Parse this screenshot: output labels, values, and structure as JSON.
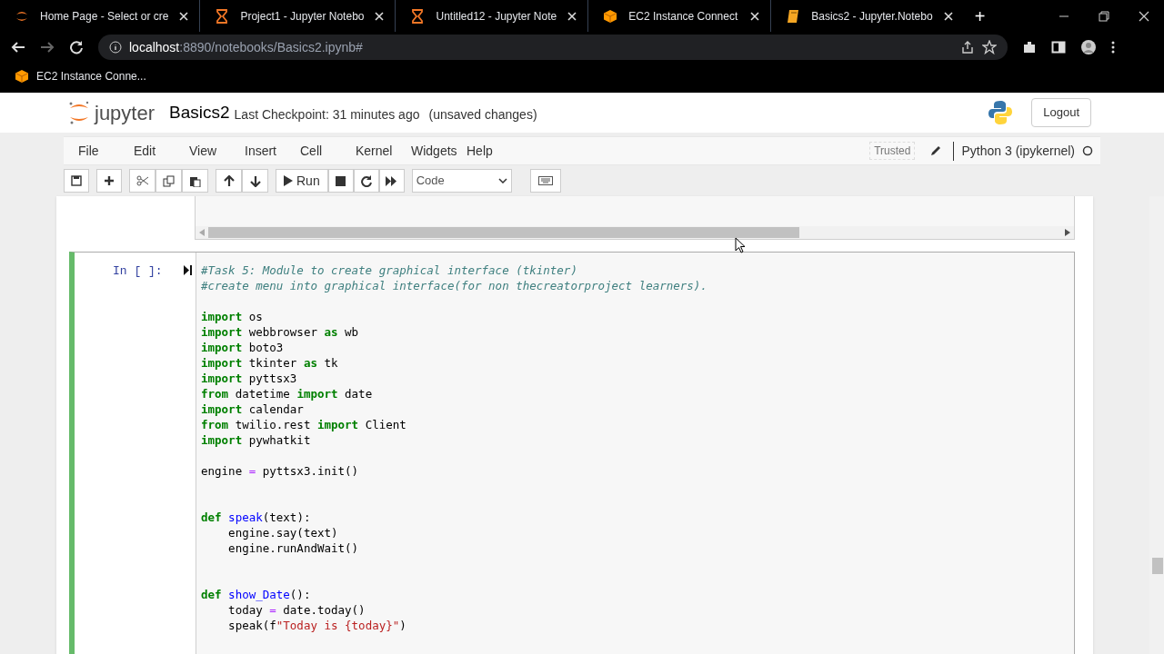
{
  "browser": {
    "tabs": [
      {
        "kind": "jupyter",
        "title": "Home Page - Select or cre"
      },
      {
        "kind": "hourglass",
        "title": "Project1 - Jupyter Notebo"
      },
      {
        "kind": "hourglass",
        "title": "Untitled12 - Jupyter Note"
      },
      {
        "kind": "cube",
        "title": "EC2 Instance Connect"
      },
      {
        "kind": "book",
        "title": "Basics2 - Jupyter.Notebo"
      }
    ],
    "new_tab": "+",
    "url_host": "localhost",
    "url_rest": ":8890/notebooks/Basics2.ipynb#",
    "bookmarks": [
      {
        "kind": "cube",
        "title": "EC2 Instance Conne..."
      }
    ]
  },
  "header": {
    "logo_text": "jupyter",
    "notebook_name": "Basics2",
    "checkpoint": "Last Checkpoint: 31 minutes ago",
    "unsaved": "(unsaved changes)",
    "logout": "Logout"
  },
  "menu": {
    "items": [
      "File",
      "Edit",
      "View",
      "Insert",
      "Cell",
      "Kernel",
      "Widgets",
      "Help"
    ],
    "trusted": "Trusted",
    "kernel": "Python 3 (ipykernel)"
  },
  "toolbar": {
    "run": "Run",
    "cell_type": "Code"
  },
  "cell": {
    "prompt": "In [ ]:",
    "lines": [
      {
        "kind": "code",
        "tokens": [
          {
            "kind": "comment",
            "text": "#Task 5: Module to create graphical interface (tkinter)"
          }
        ]
      },
      {
        "kind": "code",
        "tokens": [
          {
            "kind": "comment",
            "text": "#create menu into graphical interface(for non thecreatorproject learners)."
          }
        ]
      },
      {
        "kind": "blank"
      },
      {
        "kind": "code",
        "tokens": [
          {
            "kind": "kw",
            "text": "import"
          },
          {
            "kind": "plain",
            "text": " os"
          }
        ]
      },
      {
        "kind": "code",
        "tokens": [
          {
            "kind": "kw",
            "text": "import"
          },
          {
            "kind": "plain",
            "text": " webbrowser "
          },
          {
            "kind": "kw",
            "text": "as"
          },
          {
            "kind": "plain",
            "text": " wb"
          }
        ]
      },
      {
        "kind": "code",
        "tokens": [
          {
            "kind": "kw",
            "text": "import"
          },
          {
            "kind": "plain",
            "text": " boto3"
          }
        ]
      },
      {
        "kind": "code",
        "tokens": [
          {
            "kind": "kw",
            "text": "import"
          },
          {
            "kind": "plain",
            "text": " tkinter "
          },
          {
            "kind": "kw",
            "text": "as"
          },
          {
            "kind": "plain",
            "text": " tk"
          }
        ]
      },
      {
        "kind": "code",
        "tokens": [
          {
            "kind": "kw",
            "text": "import"
          },
          {
            "kind": "plain",
            "text": " pyttsx3"
          }
        ]
      },
      {
        "kind": "code",
        "tokens": [
          {
            "kind": "kw",
            "text": "from"
          },
          {
            "kind": "plain",
            "text": " datetime "
          },
          {
            "kind": "kw",
            "text": "import"
          },
          {
            "kind": "plain",
            "text": " date"
          }
        ]
      },
      {
        "kind": "code",
        "tokens": [
          {
            "kind": "kw",
            "text": "import"
          },
          {
            "kind": "plain",
            "text": " calendar"
          }
        ]
      },
      {
        "kind": "code",
        "tokens": [
          {
            "kind": "kw",
            "text": "from"
          },
          {
            "kind": "plain",
            "text": " twilio.rest "
          },
          {
            "kind": "kw",
            "text": "import"
          },
          {
            "kind": "plain",
            "text": " Client"
          }
        ]
      },
      {
        "kind": "code",
        "tokens": [
          {
            "kind": "kw",
            "text": "import"
          },
          {
            "kind": "plain",
            "text": " pywhatkit"
          }
        ]
      },
      {
        "kind": "blank"
      },
      {
        "kind": "code",
        "tokens": [
          {
            "kind": "plain",
            "text": "engine "
          },
          {
            "kind": "op",
            "text": "="
          },
          {
            "kind": "plain",
            "text": " pyttsx3.init()"
          }
        ]
      },
      {
        "kind": "blank"
      },
      {
        "kind": "blank"
      },
      {
        "kind": "code",
        "tokens": [
          {
            "kind": "kw",
            "text": "def "
          },
          {
            "kind": "fn",
            "text": "speak"
          },
          {
            "kind": "plain",
            "text": "(text):"
          }
        ]
      },
      {
        "kind": "code",
        "tokens": [
          {
            "kind": "plain",
            "text": "    engine.say(text)"
          }
        ]
      },
      {
        "kind": "code",
        "tokens": [
          {
            "kind": "plain",
            "text": "    engine.runAndWait()"
          }
        ]
      },
      {
        "kind": "blank"
      },
      {
        "kind": "blank"
      },
      {
        "kind": "code",
        "tokens": [
          {
            "kind": "kw",
            "text": "def "
          },
          {
            "kind": "fn",
            "text": "show_Date"
          },
          {
            "kind": "plain",
            "text": "():"
          }
        ]
      },
      {
        "kind": "code",
        "tokens": [
          {
            "kind": "plain",
            "text": "    today "
          },
          {
            "kind": "op",
            "text": "="
          },
          {
            "kind": "plain",
            "text": " date.today()"
          }
        ]
      },
      {
        "kind": "code",
        "tokens": [
          {
            "kind": "plain",
            "text": "    speak(f"
          },
          {
            "kind": "str",
            "text": "\"Today is {today}\""
          },
          {
            "kind": "plain",
            "text": ")"
          }
        ]
      }
    ]
  }
}
